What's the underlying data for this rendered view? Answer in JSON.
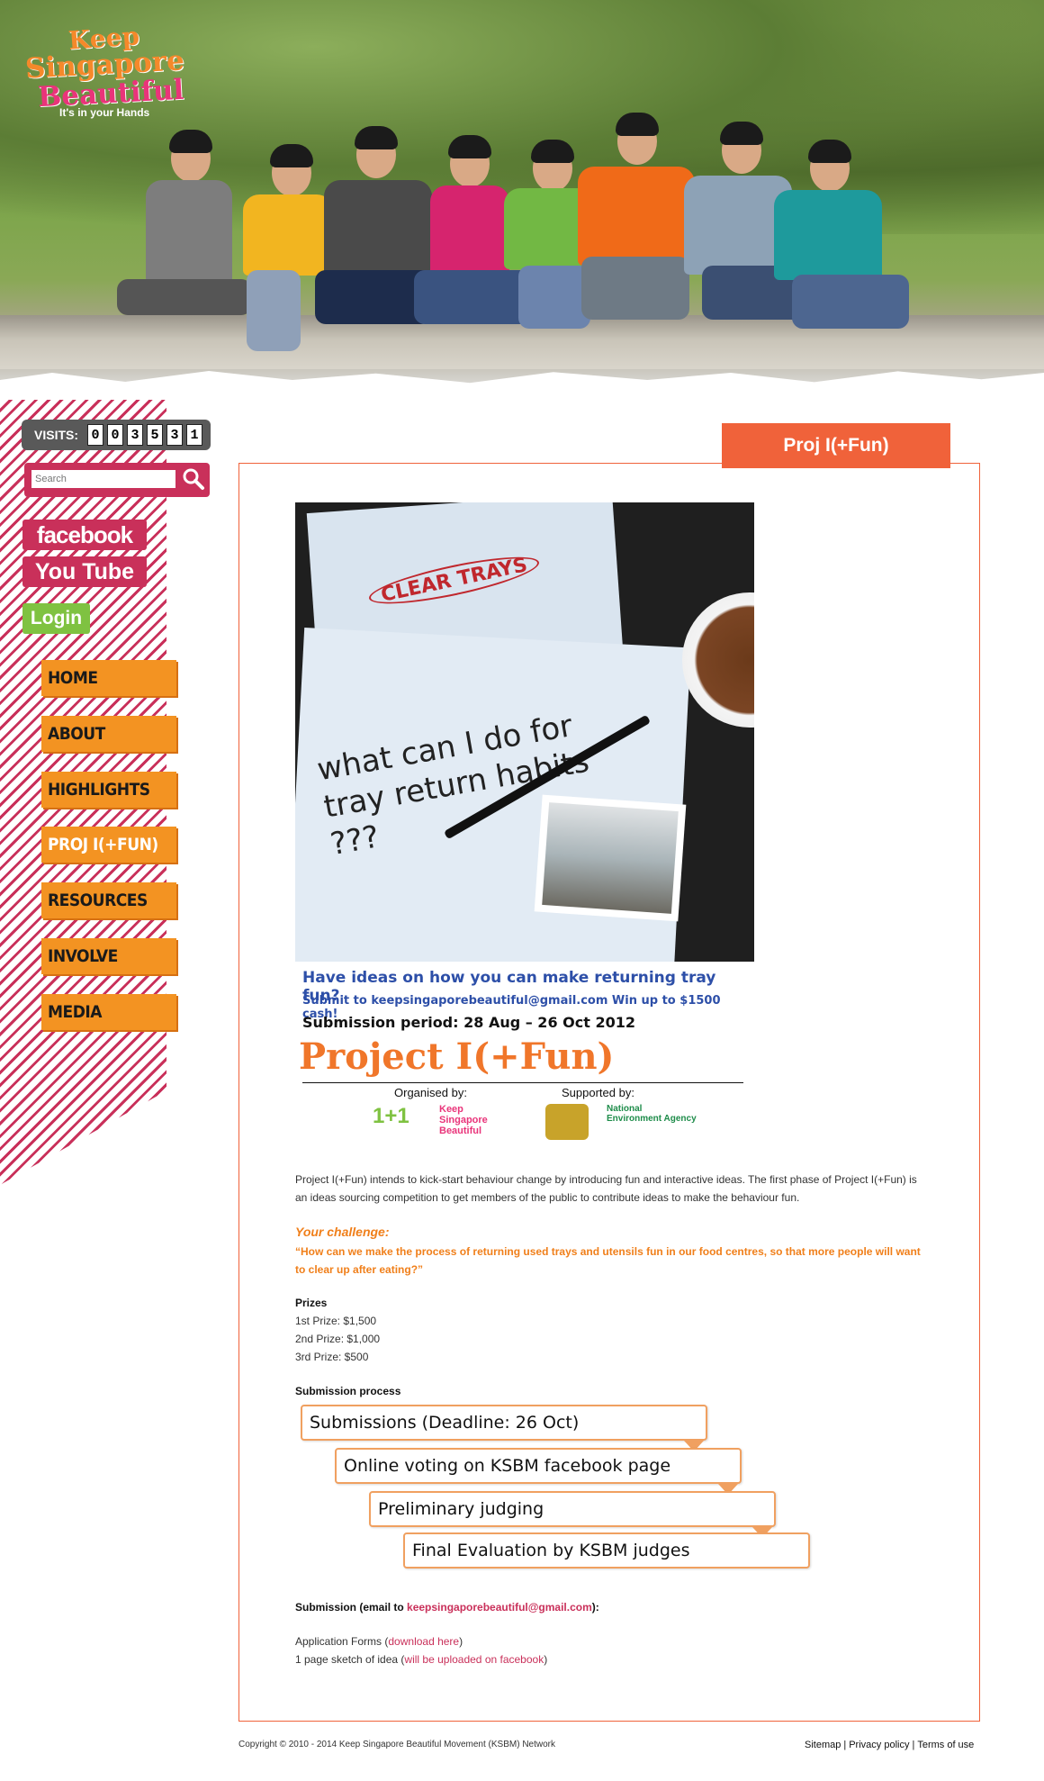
{
  "brand": {
    "logo_line1": "Keep",
    "logo_line2": "Singapore",
    "logo_line3": "Beautiful",
    "tagline": "It's in your Hands",
    "colors": {
      "pink": "#c9305a",
      "orange": "#f39322",
      "coral": "#f0623a",
      "green": "#7fc241"
    }
  },
  "sidebar": {
    "visits_label": "VISITS:",
    "visit_digits": [
      "0",
      "0",
      "3",
      "5",
      "3",
      "1"
    ],
    "search_placeholder": "Search",
    "facebook_label": "facebook",
    "youtube_label": "You Tube",
    "login_label": "Login",
    "nav": [
      {
        "label": "HOME"
      },
      {
        "label": "ABOUT"
      },
      {
        "label": "HIGHLIGHTS"
      },
      {
        "label": "PROJ I(+FUN)"
      },
      {
        "label": "RESOURCES"
      },
      {
        "label": "INVOLVE"
      },
      {
        "label": "MEDIA"
      }
    ]
  },
  "main": {
    "title": "Proj I(+Fun)",
    "poster": {
      "clear_trays": "CLEAR TRAYS",
      "scribble": "what can I do for tray return habits ???",
      "line1": "Have ideas on how you can make returning tray fun?",
      "line2": "Submit to keepsingaporebeautiful@gmail.com   Win up to $1500 cash!",
      "line3": "Submission period: 28 Aug – 26 Oct 2012",
      "project_title": "Project I(+Fun)",
      "organised_by": "Organised by:",
      "supported_by": "Supported by:",
      "logo_1plus1": "1+1",
      "logo_ksb": "Keep Singapore Beautiful",
      "logo_nea": "National Environment Agency"
    },
    "intro": "Project I(+Fun) intends to kick-start behaviour change by introducing fun and interactive ideas. The first phase of Project I(+Fun) is an ideas sourcing competition to get members of the public to contribute ideas to make the behaviour fun.",
    "challenge_heading": "Your challenge:",
    "challenge_question": "“How can we make the process of returning used trays and utensils fun in our food centres, so that more people will want to clear up after eating?”",
    "prizes_heading": "Prizes",
    "prizes": [
      "1st Prize: $1,500",
      "2nd Prize: $1,000",
      "3rd Prize: $500"
    ],
    "submission_process_heading": "Submission process",
    "process_steps": [
      "Submissions (Deadline: 26 Oct)",
      "Online voting on KSBM facebook page",
      "Preliminary judging",
      "Final Evaluation by KSBM judges"
    ],
    "submission_email_prefix": "Submission (email to ",
    "submission_email": "keepsingaporebeautiful@gmail.com",
    "submission_email_suffix": "):",
    "forms_prefix": "Application Forms (",
    "forms_link": "download here",
    "forms_suffix": ")",
    "sketch_prefix": "1 page sketch of idea (",
    "sketch_link": "will be uploaded on facebook",
    "sketch_suffix": ")"
  },
  "footer": {
    "copyright": "Copyright © 2010 - 2014 Keep Singapore Beautiful Movement (KSBM) Network",
    "links": [
      "Sitemap",
      "Privacy policy",
      "Terms of use"
    ]
  }
}
